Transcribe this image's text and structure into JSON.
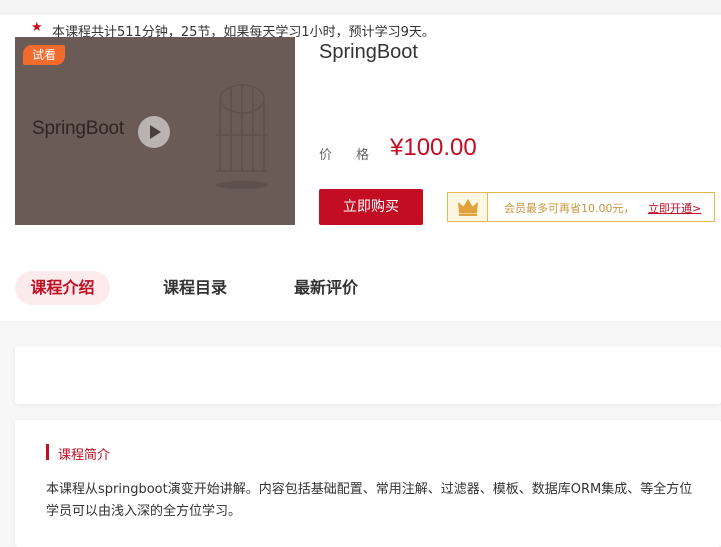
{
  "cover": {
    "badge": "试看",
    "title": "SpringBoot"
  },
  "course": {
    "title": "SpringBoot",
    "price_label": "价格",
    "price": "¥100.00",
    "buy_label": "立即购买"
  },
  "vip": {
    "text": "会员最多可再省10.00元，",
    "link": "立即开通>"
  },
  "tabs": [
    {
      "label": "课程介绍",
      "active": true
    },
    {
      "label": "课程目录",
      "active": false
    },
    {
      "label": "最新评价",
      "active": false
    }
  ],
  "summary": {
    "text": "本课程共计511分钟，25节，如果每天学习1小时，预计学习9天。"
  },
  "intro": {
    "heading": "课程简介",
    "line1": "本课程从springboot演变开始讲解。内容包括基础配置、常用注解、过滤器、模板、数据库ORM集成、等全方位",
    "line2": "学员可以由浅入深的全方位学习。"
  },
  "colors": {
    "accent": "#c30d23",
    "badge": "#f36b2c",
    "vip_gold": "#e7b84e",
    "cover_bg": "#6a5b57"
  }
}
